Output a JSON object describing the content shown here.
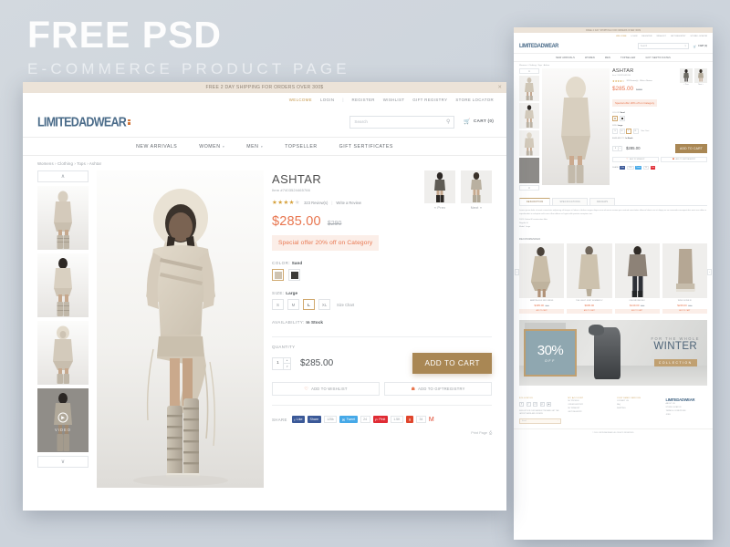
{
  "poster": {
    "title": "FREE PSD",
    "subtitle": "E-COMMERCE PRODUCT PAGE"
  },
  "announcement": {
    "text": "FREE 2 DAY SHIPPING FOR ORDERS OVER 300$",
    "close_icon": "✕"
  },
  "utility_nav": {
    "welcome": "WELCOME",
    "items": [
      "LOGIN",
      "REGISTER",
      "WISHLIST",
      "GIFT REGISTRY",
      "STORE LOCATOR"
    ],
    "separator": "|"
  },
  "brand": {
    "name": "LIMITEDADWEAR",
    "accent": "#d2763a"
  },
  "search": {
    "placeholder": "Search",
    "icon": "search-icon"
  },
  "cart": {
    "label": "CART (0)",
    "icon": "cart-icon"
  },
  "main_nav": {
    "items": [
      {
        "label": "NEW ARRIVALS",
        "caret": false
      },
      {
        "label": "WOMEN",
        "caret": true
      },
      {
        "label": "MEN",
        "caret": true
      },
      {
        "label": "TOPSELLER",
        "caret": false
      },
      {
        "label": "GIFT SERTIFICATES",
        "caret": false
      }
    ],
    "caret_glyph": "▾"
  },
  "breadcrumb": {
    "text": "Womens › Clothing › Tops › Ashtar"
  },
  "gallery": {
    "up_arrow": "∧",
    "down_arrow": "∨",
    "video_label": "VIDEO",
    "play_glyph": "▶",
    "prev_label": "« Prev",
    "next_label": "Next »"
  },
  "product": {
    "title": "ASHTAR",
    "item_number": "Item #7403524465766",
    "stars_filled": 4,
    "stars_total": 5,
    "review_count": "323 Review(s)",
    "write_review": "Write a Review",
    "price_current": "$285.00",
    "price_old": "$290",
    "special_offer": "Special offer 20% off on Category",
    "color_label": "COLOR:",
    "color_value": "Sand",
    "colors": [
      {
        "name": "sand",
        "hex": "#cfc3b0",
        "selected": true
      },
      {
        "name": "charcoal",
        "hex": "#3c3a37",
        "selected": false
      }
    ],
    "size_label": "SIZE:",
    "size_value": "Large",
    "sizes": [
      {
        "label": "S",
        "selected": false
      },
      {
        "label": "M",
        "selected": false
      },
      {
        "label": "L",
        "selected": true
      },
      {
        "label": "XL",
        "selected": false
      }
    ],
    "size_chart": "Size Chart",
    "availability_label": "AVAILABILITY:",
    "availability_value": "In Stock",
    "quantity_label": "QUANTITY",
    "quantity_value": "1",
    "stepper_up": "▴",
    "stepper_down": "▾",
    "buy_price": "$285.00",
    "add_to_cart": "ADD TO CART",
    "add_to_wishlist": "ADD TO WISHLIST",
    "add_to_giftregistry": "ADD TO GIFTREGISTRY",
    "wishlist_icon": "♡",
    "giftregistry_icon": "☗",
    "print_page": "Print Page",
    "print_icon": "⎙"
  },
  "share": {
    "label": "SHARE",
    "buttons": [
      {
        "name": "facebook-like",
        "glyph": "f",
        "text": "Like",
        "count": "125k",
        "color": "#3b5998"
      },
      {
        "name": "facebook-share",
        "glyph": "",
        "text": "Share",
        "count": "",
        "color": "#3b5998"
      },
      {
        "name": "twitter-tweet",
        "glyph": "✉",
        "text": "Tweet",
        "count": "24",
        "color": "#46a9e8"
      },
      {
        "name": "pinterest-pin",
        "glyph": "P",
        "text": "Pinit",
        "count": "1.5K",
        "color": "#e02b34"
      },
      {
        "name": "google-plus",
        "glyph": "g",
        "text": "",
        "count": "34",
        "color": "#e0452c"
      },
      {
        "name": "email",
        "glyph": "M",
        "text": "",
        "count": "",
        "color": "#e0452c"
      }
    ]
  },
  "tabs": {
    "items": [
      {
        "label": "DESCRIPTION",
        "active": true
      },
      {
        "label": "SPECIFICATIONS",
        "active": false
      },
      {
        "label": "REVIEWS",
        "active": false
      }
    ],
    "body_text": "Lorem ipsum dolor sit amet consectetur adipiscing elit tempor ut labore et dolore magna aliqua enim ad minim veniam quis nostrud exercitation ullamco laboris nisi ut aliquip ex ea commodo consequat duis aute irure dolor in reprehenderit in voluptate velit esse cillum dolore eu fugiat nulla pariatur excepteur sint.",
    "bullets": [
      "100% Cotton fill construction fiber",
      "Regular fit",
      "Model: Large"
    ]
  },
  "recommended": {
    "heading": "RECOMMENDED",
    "prev": "‹",
    "next": "›",
    "products": [
      {
        "name": "MANTRA SILK MIX DRESS",
        "price": "$495.00",
        "old": "$590",
        "button": "ADD TO CART"
      },
      {
        "name": "THE LIGHT JOINT BOMBER IV",
        "price": "$695.00",
        "old": "",
        "button": "ADD TO CART"
      },
      {
        "name": "ODE BROWN BLK",
        "price": "$149.00",
        "old": "$190",
        "button": "ADD TO CART"
      },
      {
        "name": "WIND DOWN III",
        "price": "$249.00",
        "old": "$310",
        "button": "ADD TO CART"
      }
    ]
  },
  "banner": {
    "discount": "30%",
    "off": "OFF",
    "line1": "FOR THE WHOLE",
    "line2": "WINTER",
    "line3": "COLLECTION"
  },
  "footer": {
    "social_heading": "FOLLOW US",
    "social_icons": [
      "facebook-icon",
      "twitter-icon",
      "instagram-icon",
      "pinterest-icon",
      "youtube-icon"
    ],
    "newsletter_text": "SIGN UP FOR OUR NEWSLETTER AND GET THE LATEST NEWS AND OFFERS",
    "newsletter_placeholder": "Email",
    "newsletter_submit": "›",
    "columns": [
      {
        "heading": "MY ACCOUNT",
        "links": [
          "MY PROFILE",
          "ORDER HISTORY",
          "MY WISHLIST",
          "GIFT REGISTRY"
        ]
      },
      {
        "heading": "CUSTOMER SERVICE",
        "links": [
          "CONTACT US",
          "FAQ",
          "SHIPPING"
        ]
      }
    ],
    "logo": "LIMITEDADWEAR",
    "brand_links": [
      "ABOUT US",
      "STORE LOCATOR",
      "TERMS & CONDITIONS",
      "JOBS"
    ],
    "copyright": "© 2014 LIMITEDADWEAR. ALL RIGHTS RESERVED."
  },
  "colors": {
    "accent_orange": "#e8764f",
    "gold": "#c7994e",
    "cart_brown": "#a98754",
    "logo_blue": "#4a6b89",
    "cream": "#ece3d8"
  }
}
